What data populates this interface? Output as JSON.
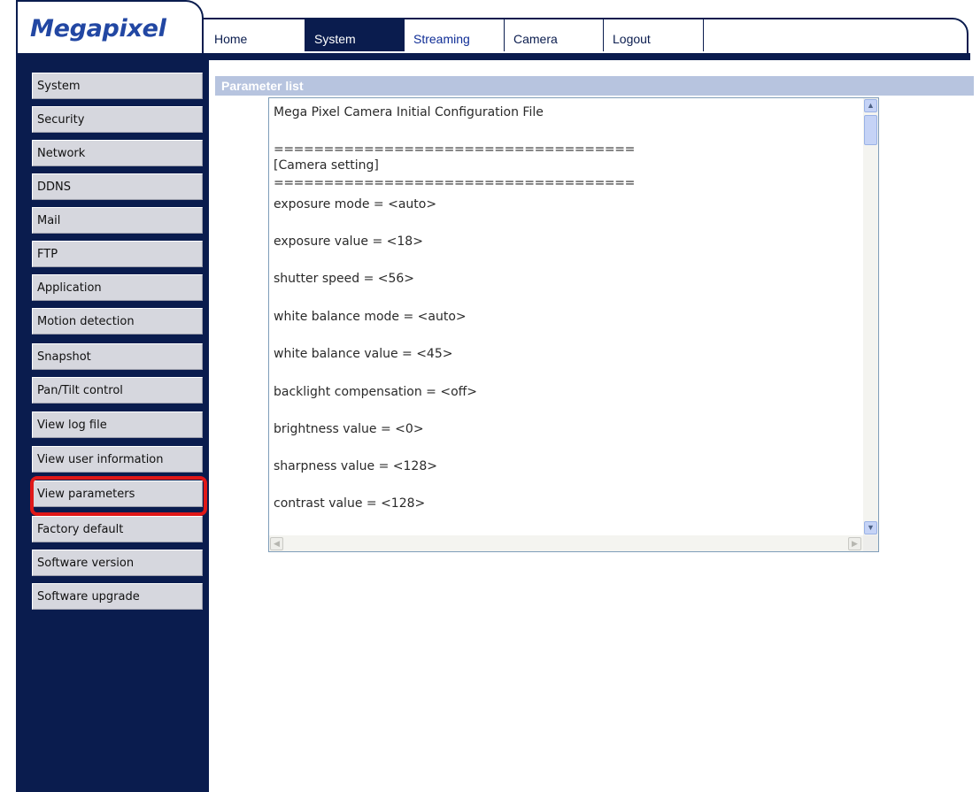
{
  "brand": {
    "logo": "Megapixel"
  },
  "nav": {
    "tabs": [
      "Home",
      "System",
      "Streaming",
      "Camera",
      "Logout"
    ],
    "active": "System"
  },
  "sidebar": {
    "items": [
      "System",
      "Security",
      "Network",
      "DDNS",
      "Mail",
      "FTP",
      "Application",
      "Motion detection",
      "Snapshot",
      "Pan/Tilt control",
      "View log file",
      "View user information",
      "View parameters",
      "Factory default",
      "Software version",
      "Software upgrade"
    ],
    "selected": "View parameters"
  },
  "section": {
    "title": "Parameter list"
  },
  "parameters": {
    "lines": [
      "Mega Pixel Camera Initial Configuration File",
      "====================================",
      "[Camera setting]",
      "====================================",
      "exposure mode = <auto>",
      "exposure value = <18>",
      "shutter speed = <56>",
      "white balance mode = <auto>",
      "white balance value = <45>",
      "backlight compensation = <off>",
      "brightness value = <0>",
      "sharpness value = <128>",
      "contrast value = <128>"
    ]
  },
  "colors": {
    "navy": "#0a1c4e",
    "logo": "#2247a3",
    "header_band": "#b7c4df",
    "highlight": "#e01818"
  },
  "icons": {
    "scroll_up": "chevron-up-icon",
    "scroll_down": "chevron-down-icon",
    "scroll_left": "chevron-left-icon",
    "scroll_right": "chevron-right-icon"
  }
}
